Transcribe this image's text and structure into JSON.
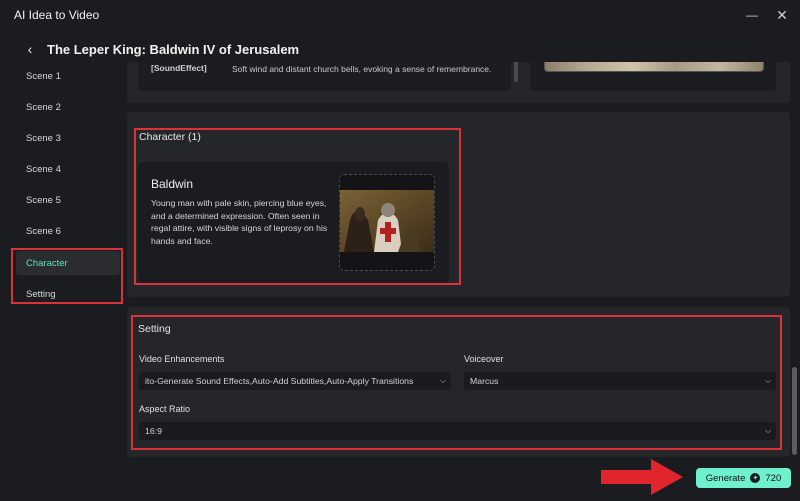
{
  "window": {
    "title": "AI Idea to Video"
  },
  "header": {
    "title": "The Leper King: Baldwin IV of Jerusalem"
  },
  "sidebar": {
    "items": [
      {
        "label": "Scene 1"
      },
      {
        "label": "Scene 2"
      },
      {
        "label": "Scene 3"
      },
      {
        "label": "Scene 4"
      },
      {
        "label": "Scene 5"
      },
      {
        "label": "Scene 6"
      },
      {
        "label": "Character"
      },
      {
        "label": "Setting"
      }
    ],
    "active": "Character"
  },
  "scene": {
    "sound_effect_key": "[SoundEffect]",
    "sound_effect_text": "Soft wind and distant church bells, evoking a sense of remembrance."
  },
  "character": {
    "section_label": "Character (1)",
    "name": "Baldwin",
    "description": "Young man with pale skin, piercing blue eyes, and a determined expression. Often seen in regal attire, with visible signs of leprosy on his hands and face."
  },
  "setting": {
    "section_label": "Setting",
    "video_enhancements_label": "Video Enhancements",
    "video_enhancements_value": "ito-Generate Sound Effects,Auto-Add Subtitles,Auto-Apply Transitions",
    "voiceover_label": "Voiceover",
    "voiceover_value": "Marcus",
    "aspect_ratio_label": "Aspect Ratio",
    "aspect_ratio_value": "16:9"
  },
  "footer": {
    "generate_label": "Generate",
    "credits": "720"
  },
  "colors": {
    "accent": "#6ff0cf",
    "active_text": "#5fe0c7",
    "highlight": "#d9323a",
    "background": "#1b1c1f",
    "panel": "#24262a"
  }
}
